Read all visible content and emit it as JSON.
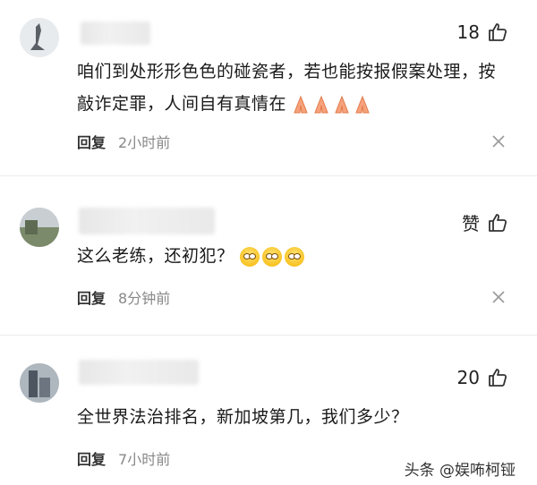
{
  "comments": [
    {
      "likes": "18",
      "text": "咱们到处形形色色的碰瓷者，若也能按报假案处理，按敲诈定罪，人间自有真情在",
      "reply_label": "回复",
      "time": "2小时前"
    },
    {
      "likes": "赞",
      "text": "这么老练，还初犯？",
      "reply_label": "回复",
      "time": "8分钟前"
    },
    {
      "likes": "20",
      "text": "全世界法治排名，新加坡第几，我们多少？",
      "reply_label": "回复",
      "time": "7小时前"
    }
  ],
  "watermark": "头条 @娱咘柯铔",
  "icons": {
    "like": "thumbs-up-icon",
    "dismiss": "close-icon",
    "emoji_pray": "praying-hands-icon",
    "emoji_sob": "crying-face-icon"
  },
  "colors": {
    "background": "#ffffff",
    "text": "#1a1a1a",
    "time": "#888888",
    "divider": "#ececec"
  }
}
